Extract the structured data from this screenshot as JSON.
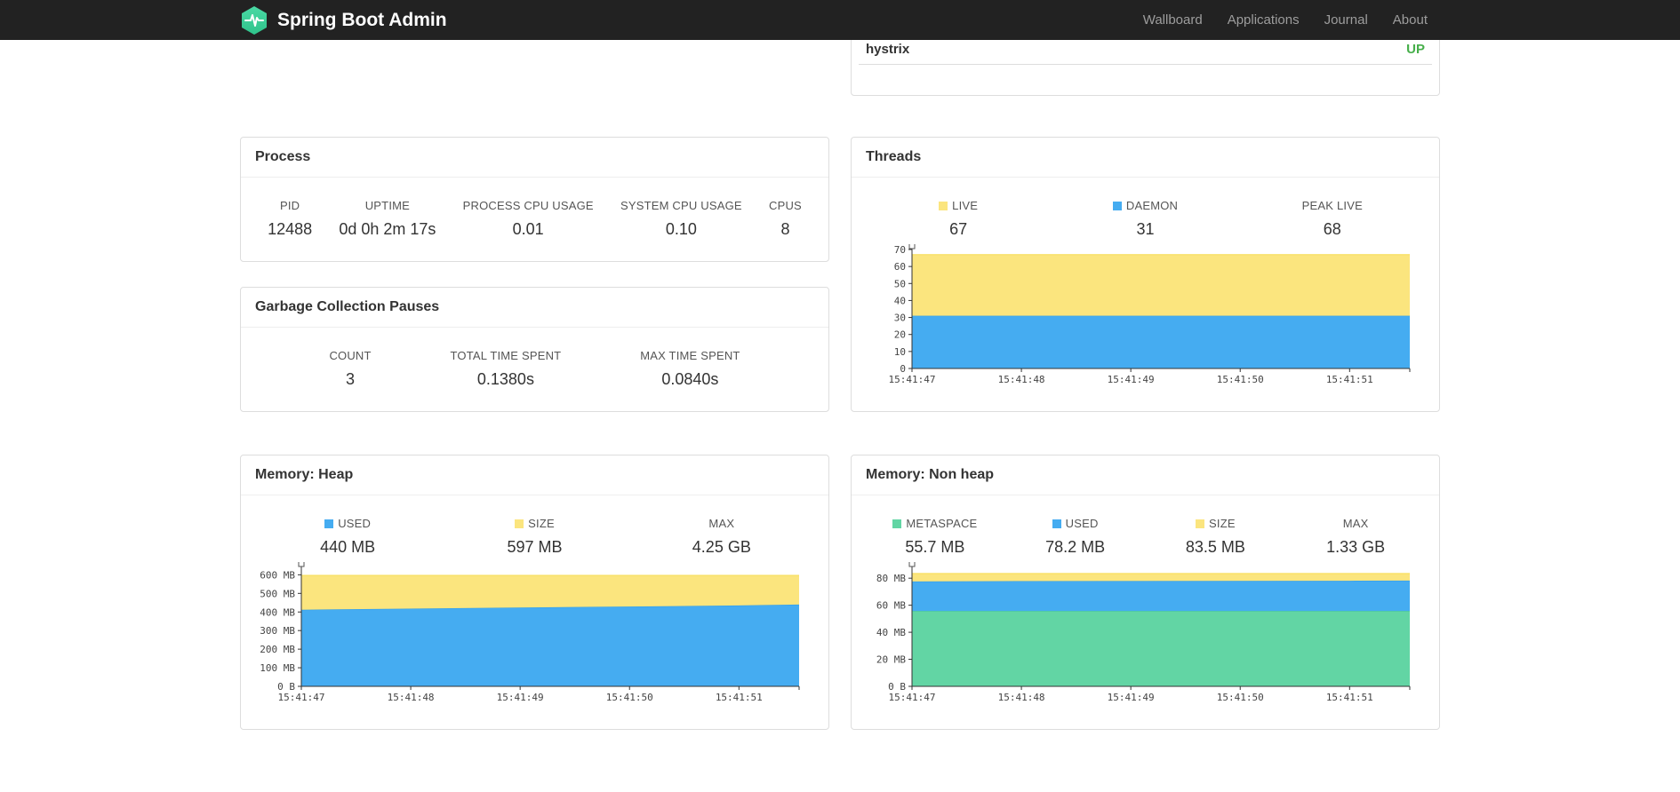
{
  "navbar": {
    "brand": "Spring Boot Admin",
    "items": [
      "Wallboard",
      "Applications",
      "Journal",
      "About"
    ]
  },
  "health": {
    "service": "hystrix",
    "status": "UP",
    "status_color": "#47af4b"
  },
  "process": {
    "title": "Process",
    "metrics": [
      {
        "label": "PID",
        "value": "12488"
      },
      {
        "label": "UPTIME",
        "value": "0d 0h 2m 17s"
      },
      {
        "label": "PROCESS CPU USAGE",
        "value": "0.01"
      },
      {
        "label": "SYSTEM CPU USAGE",
        "value": "0.10"
      },
      {
        "label": "CPUS",
        "value": "8"
      }
    ]
  },
  "gc": {
    "title": "Garbage Collection Pauses",
    "metrics": [
      {
        "label": "COUNT",
        "value": "3"
      },
      {
        "label": "TOTAL TIME SPENT",
        "value": "0.1380s"
      },
      {
        "label": "MAX TIME SPENT",
        "value": "0.0840s"
      }
    ]
  },
  "threads": {
    "title": "Threads",
    "metrics": [
      {
        "label": "LIVE",
        "value": "67",
        "swatch": "#fbe57e"
      },
      {
        "label": "DAEMON",
        "value": "31",
        "swatch": "#45acf1"
      },
      {
        "label": "PEAK LIVE",
        "value": "68"
      }
    ]
  },
  "heap": {
    "title": "Memory: Heap",
    "metrics": [
      {
        "label": "USED",
        "value": "440 MB",
        "swatch": "#45acf1"
      },
      {
        "label": "SIZE",
        "value": "597 MB",
        "swatch": "#fbe57e"
      },
      {
        "label": "MAX",
        "value": "4.25 GB"
      }
    ]
  },
  "nonheap": {
    "title": "Memory: Non heap",
    "metrics": [
      {
        "label": "METASPACE",
        "value": "55.7 MB",
        "swatch": "#62d5a4"
      },
      {
        "label": "USED",
        "value": "78.2 MB",
        "swatch": "#45acf1"
      },
      {
        "label": "SIZE",
        "value": "83.5 MB",
        "swatch": "#fbe57e"
      },
      {
        "label": "MAX",
        "value": "1.33 GB"
      }
    ]
  },
  "chart_data": [
    {
      "id": "threads",
      "type": "area",
      "title": "Threads",
      "xlabel": "",
      "ylabel": "",
      "x": [
        0,
        1,
        2,
        3,
        4,
        4.55
      ],
      "xlim": [
        0,
        4.55
      ],
      "ylim": [
        0,
        70
      ],
      "x_ticks": [
        {
          "v": 0,
          "label": "15:41:47"
        },
        {
          "v": 1,
          "label": "15:41:48"
        },
        {
          "v": 2,
          "label": "15:41:49"
        },
        {
          "v": 3,
          "label": "15:41:50"
        },
        {
          "v": 4,
          "label": "15:41:51"
        }
      ],
      "y_ticks": [
        {
          "v": 0,
          "label": "0"
        },
        {
          "v": 10,
          "label": "10"
        },
        {
          "v": 20,
          "label": "20"
        },
        {
          "v": 30,
          "label": "30"
        },
        {
          "v": 40,
          "label": "40"
        },
        {
          "v": 50,
          "label": "50"
        },
        {
          "v": 60,
          "label": "60"
        },
        {
          "v": 70,
          "label": "70"
        }
      ],
      "series": [
        {
          "name": "DAEMON",
          "color": "#45acf1",
          "edge": "#2e9be8",
          "values": [
            31,
            31,
            31,
            31,
            31,
            31
          ]
        },
        {
          "name": "LIVE",
          "color": "#fbe57e",
          "edge": "#f7dd55",
          "values": [
            67,
            67,
            67,
            67,
            67,
            67
          ]
        }
      ],
      "legend_position": "top"
    },
    {
      "id": "memory-heap",
      "type": "area",
      "title": "Memory: Heap",
      "xlabel": "",
      "ylabel": "",
      "x": [
        0,
        1,
        2,
        3,
        4,
        4.55
      ],
      "xlim": [
        0,
        4.55
      ],
      "ylim": [
        0,
        640
      ],
      "x_ticks": [
        {
          "v": 0,
          "label": "15:41:47"
        },
        {
          "v": 1,
          "label": "15:41:48"
        },
        {
          "v": 2,
          "label": "15:41:49"
        },
        {
          "v": 3,
          "label": "15:41:50"
        },
        {
          "v": 4,
          "label": "15:41:51"
        }
      ],
      "y_ticks": [
        {
          "v": 0,
          "label": "0 B"
        },
        {
          "v": 100,
          "label": "100 MB"
        },
        {
          "v": 200,
          "label": "200 MB"
        },
        {
          "v": 300,
          "label": "300 MB"
        },
        {
          "v": 400,
          "label": "400 MB"
        },
        {
          "v": 500,
          "label": "500 MB"
        },
        {
          "v": 600,
          "label": "600 MB"
        }
      ],
      "series": [
        {
          "name": "USED",
          "color": "#45acf1",
          "edge": "#2e9be8",
          "values": [
            412,
            418,
            424,
            429,
            435,
            440
          ]
        },
        {
          "name": "SIZE",
          "color": "#fbe57e",
          "edge": "#f7dd55",
          "values": [
            597,
            597,
            597,
            597,
            597,
            597
          ]
        }
      ],
      "legend_position": "top"
    },
    {
      "id": "memory-nonheap",
      "type": "area",
      "title": "Memory: Non heap",
      "xlabel": "",
      "ylabel": "",
      "x": [
        0,
        1,
        2,
        3,
        4,
        4.55
      ],
      "xlim": [
        0,
        4.55
      ],
      "ylim": [
        0,
        88
      ],
      "x_ticks": [
        {
          "v": 0,
          "label": "15:41:47"
        },
        {
          "v": 1,
          "label": "15:41:48"
        },
        {
          "v": 2,
          "label": "15:41:49"
        },
        {
          "v": 3,
          "label": "15:41:50"
        },
        {
          "v": 4,
          "label": "15:41:51"
        }
      ],
      "y_ticks": [
        {
          "v": 0,
          "label": "0 B"
        },
        {
          "v": 20,
          "label": "20 MB"
        },
        {
          "v": 40,
          "label": "40 MB"
        },
        {
          "v": 60,
          "label": "60 MB"
        },
        {
          "v": 80,
          "label": "80 MB"
        }
      ],
      "series": [
        {
          "name": "METASPACE",
          "color": "#62d5a4",
          "edge": "#46c795",
          "values": [
            55.7,
            55.7,
            55.7,
            55.7,
            55.7,
            55.7
          ]
        },
        {
          "name": "USED",
          "color": "#45acf1",
          "edge": "#2e9be8",
          "values": [
            77.6,
            77.8,
            77.9,
            78.0,
            78.1,
            78.2
          ]
        },
        {
          "name": "SIZE",
          "color": "#fbe57e",
          "edge": "#f7dd55",
          "values": [
            83.5,
            83.5,
            83.5,
            83.5,
            83.5,
            83.5
          ]
        }
      ],
      "legend_position": "top"
    }
  ]
}
